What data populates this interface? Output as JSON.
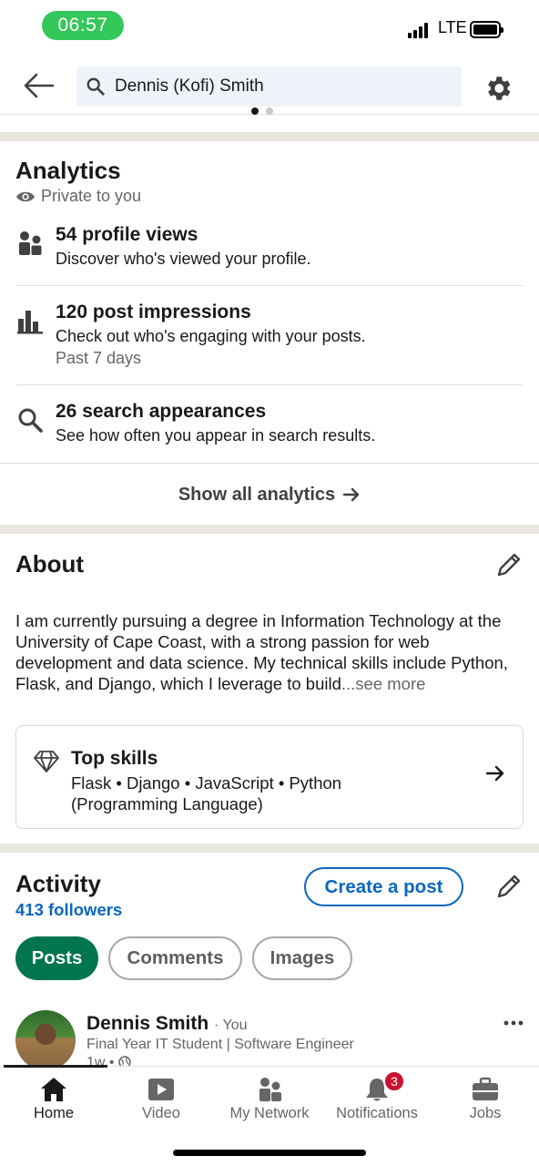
{
  "status_bar": {
    "time": "06:57",
    "network": "LTE"
  },
  "header": {
    "search_value": "Dennis (Kofi) Smith",
    "icons": [
      "back-arrow-icon",
      "search-icon",
      "gear-icon"
    ]
  },
  "analytics": {
    "title": "Analytics",
    "privacy": "Private to you",
    "items": [
      {
        "icon": "people-icon",
        "title": "54 profile views",
        "subtitle": "Discover who's viewed your profile.",
        "note": ""
      },
      {
        "icon": "bar-chart-icon",
        "title": "120 post impressions",
        "subtitle": "Check out who's engaging with your posts.",
        "note": "Past 7 days"
      },
      {
        "icon": "search-icon",
        "title": "26 search appearances",
        "subtitle": "See how often you appear in search results.",
        "note": ""
      }
    ],
    "show_all": "Show all analytics"
  },
  "about": {
    "title": "About",
    "text": "I am currently pursuing a degree in Information Technology at the University of Cape Coast, with a strong passion for web development and data science. My technical skills include Python, Flask, and Django, which I leverage to build",
    "see_more": "...see more",
    "top_skills": {
      "title": "Top skills",
      "list": "Flask • Django • JavaScript • Python (Programming Language)"
    }
  },
  "activity": {
    "title": "Activity",
    "followers": "413 followers",
    "create_post": "Create a post",
    "tabs": [
      {
        "label": "Posts",
        "active": true
      },
      {
        "label": "Comments",
        "active": false
      },
      {
        "label": "Images",
        "active": false
      }
    ],
    "post": {
      "author": "Dennis Smith",
      "relation": "· You",
      "headline": "Final Year IT Student | Software Engineer",
      "time": "1w •"
    }
  },
  "bottom_nav": {
    "items": [
      {
        "label": "Home",
        "icon": "home-icon",
        "active": true
      },
      {
        "label": "Video",
        "icon": "video-icon",
        "active": false
      },
      {
        "label": "My Network",
        "icon": "network-icon",
        "active": false
      },
      {
        "label": "Notifications",
        "icon": "bell-icon",
        "active": false,
        "badge": "3"
      },
      {
        "label": "Jobs",
        "icon": "briefcase-icon",
        "active": false
      }
    ]
  },
  "colors": {
    "brand_blue": "#0a66c2",
    "active_green": "#01754f",
    "status_green": "#34c759",
    "badge_red": "#cb112d",
    "section_divider": "#e9e5df"
  }
}
